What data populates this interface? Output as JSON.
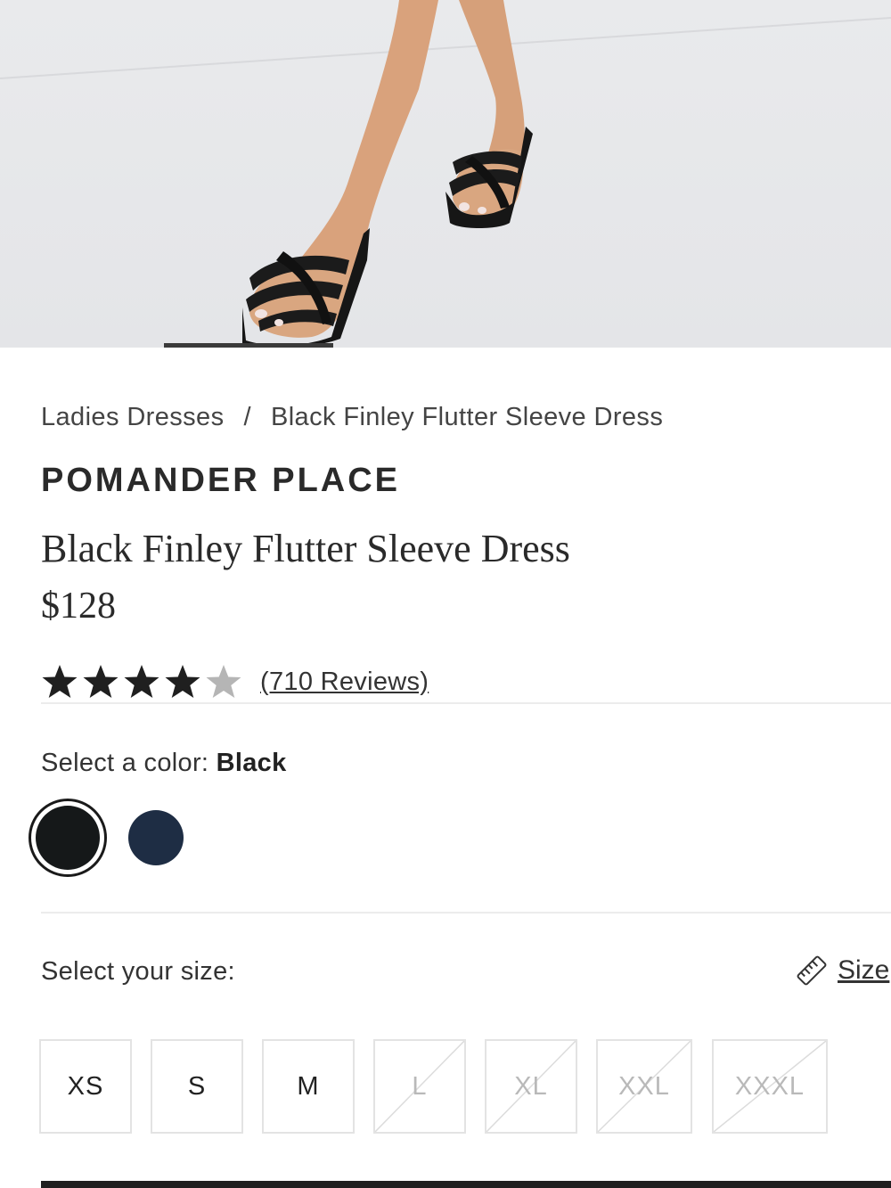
{
  "hero": {
    "image_alt_icon": "product-photo",
    "indicator_active": 1
  },
  "breadcrumb": {
    "items": [
      "Ladies Dresses",
      "Black Finley Flutter Sleeve Dress"
    ],
    "separator": "/"
  },
  "product": {
    "brand": "POMANDER PLACE",
    "title": "Black Finley Flutter Sleeve Dress",
    "price": "$128"
  },
  "rating": {
    "value": 4,
    "max": 5,
    "reviews_label": "(710 Reviews)"
  },
  "color": {
    "label": "Select a color:",
    "selected": "Black",
    "swatches": [
      {
        "name": "Black",
        "hex": "#151819",
        "selected": true
      },
      {
        "name": "Navy",
        "hex": "#1e2d44",
        "selected": false
      }
    ]
  },
  "size": {
    "label": "Select your size:",
    "guide_label": "Size",
    "guide_icon": "ruler-icon",
    "options": [
      {
        "label": "XS",
        "available": true
      },
      {
        "label": "S",
        "available": true
      },
      {
        "label": "M",
        "available": true
      },
      {
        "label": "L",
        "available": false
      },
      {
        "label": "XL",
        "available": false
      },
      {
        "label": "XXL",
        "available": false
      },
      {
        "label": "XXXL",
        "available": false
      }
    ]
  },
  "colors": {
    "text": "#222222",
    "star_filled": "#1f1f1f",
    "star_empty": "#b5b5b5",
    "disabled_text": "#b9b9b9"
  }
}
